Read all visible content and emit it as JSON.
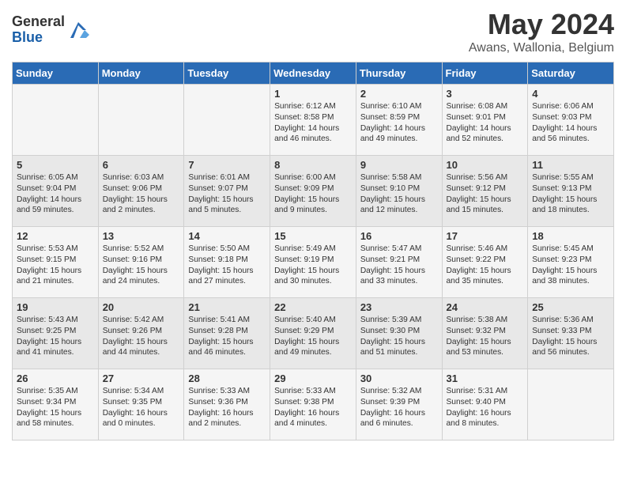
{
  "logo": {
    "general": "General",
    "blue": "Blue"
  },
  "header": {
    "month": "May 2024",
    "location": "Awans, Wallonia, Belgium"
  },
  "weekdays": [
    "Sunday",
    "Monday",
    "Tuesday",
    "Wednesday",
    "Thursday",
    "Friday",
    "Saturday"
  ],
  "weeks": [
    [
      {
        "day": "",
        "sunrise": "",
        "sunset": "",
        "daylight": ""
      },
      {
        "day": "",
        "sunrise": "",
        "sunset": "",
        "daylight": ""
      },
      {
        "day": "",
        "sunrise": "",
        "sunset": "",
        "daylight": ""
      },
      {
        "day": "1",
        "sunrise": "Sunrise: 6:12 AM",
        "sunset": "Sunset: 8:58 PM",
        "daylight": "Daylight: 14 hours and 46 minutes."
      },
      {
        "day": "2",
        "sunrise": "Sunrise: 6:10 AM",
        "sunset": "Sunset: 8:59 PM",
        "daylight": "Daylight: 14 hours and 49 minutes."
      },
      {
        "day": "3",
        "sunrise": "Sunrise: 6:08 AM",
        "sunset": "Sunset: 9:01 PM",
        "daylight": "Daylight: 14 hours and 52 minutes."
      },
      {
        "day": "4",
        "sunrise": "Sunrise: 6:06 AM",
        "sunset": "Sunset: 9:03 PM",
        "daylight": "Daylight: 14 hours and 56 minutes."
      }
    ],
    [
      {
        "day": "5",
        "sunrise": "Sunrise: 6:05 AM",
        "sunset": "Sunset: 9:04 PM",
        "daylight": "Daylight: 14 hours and 59 minutes."
      },
      {
        "day": "6",
        "sunrise": "Sunrise: 6:03 AM",
        "sunset": "Sunset: 9:06 PM",
        "daylight": "Daylight: 15 hours and 2 minutes."
      },
      {
        "day": "7",
        "sunrise": "Sunrise: 6:01 AM",
        "sunset": "Sunset: 9:07 PM",
        "daylight": "Daylight: 15 hours and 5 minutes."
      },
      {
        "day": "8",
        "sunrise": "Sunrise: 6:00 AM",
        "sunset": "Sunset: 9:09 PM",
        "daylight": "Daylight: 15 hours and 9 minutes."
      },
      {
        "day": "9",
        "sunrise": "Sunrise: 5:58 AM",
        "sunset": "Sunset: 9:10 PM",
        "daylight": "Daylight: 15 hours and 12 minutes."
      },
      {
        "day": "10",
        "sunrise": "Sunrise: 5:56 AM",
        "sunset": "Sunset: 9:12 PM",
        "daylight": "Daylight: 15 hours and 15 minutes."
      },
      {
        "day": "11",
        "sunrise": "Sunrise: 5:55 AM",
        "sunset": "Sunset: 9:13 PM",
        "daylight": "Daylight: 15 hours and 18 minutes."
      }
    ],
    [
      {
        "day": "12",
        "sunrise": "Sunrise: 5:53 AM",
        "sunset": "Sunset: 9:15 PM",
        "daylight": "Daylight: 15 hours and 21 minutes."
      },
      {
        "day": "13",
        "sunrise": "Sunrise: 5:52 AM",
        "sunset": "Sunset: 9:16 PM",
        "daylight": "Daylight: 15 hours and 24 minutes."
      },
      {
        "day": "14",
        "sunrise": "Sunrise: 5:50 AM",
        "sunset": "Sunset: 9:18 PM",
        "daylight": "Daylight: 15 hours and 27 minutes."
      },
      {
        "day": "15",
        "sunrise": "Sunrise: 5:49 AM",
        "sunset": "Sunset: 9:19 PM",
        "daylight": "Daylight: 15 hours and 30 minutes."
      },
      {
        "day": "16",
        "sunrise": "Sunrise: 5:47 AM",
        "sunset": "Sunset: 9:21 PM",
        "daylight": "Daylight: 15 hours and 33 minutes."
      },
      {
        "day": "17",
        "sunrise": "Sunrise: 5:46 AM",
        "sunset": "Sunset: 9:22 PM",
        "daylight": "Daylight: 15 hours and 35 minutes."
      },
      {
        "day": "18",
        "sunrise": "Sunrise: 5:45 AM",
        "sunset": "Sunset: 9:23 PM",
        "daylight": "Daylight: 15 hours and 38 minutes."
      }
    ],
    [
      {
        "day": "19",
        "sunrise": "Sunrise: 5:43 AM",
        "sunset": "Sunset: 9:25 PM",
        "daylight": "Daylight: 15 hours and 41 minutes."
      },
      {
        "day": "20",
        "sunrise": "Sunrise: 5:42 AM",
        "sunset": "Sunset: 9:26 PM",
        "daylight": "Daylight: 15 hours and 44 minutes."
      },
      {
        "day": "21",
        "sunrise": "Sunrise: 5:41 AM",
        "sunset": "Sunset: 9:28 PM",
        "daylight": "Daylight: 15 hours and 46 minutes."
      },
      {
        "day": "22",
        "sunrise": "Sunrise: 5:40 AM",
        "sunset": "Sunset: 9:29 PM",
        "daylight": "Daylight: 15 hours and 49 minutes."
      },
      {
        "day": "23",
        "sunrise": "Sunrise: 5:39 AM",
        "sunset": "Sunset: 9:30 PM",
        "daylight": "Daylight: 15 hours and 51 minutes."
      },
      {
        "day": "24",
        "sunrise": "Sunrise: 5:38 AM",
        "sunset": "Sunset: 9:32 PM",
        "daylight": "Daylight: 15 hours and 53 minutes."
      },
      {
        "day": "25",
        "sunrise": "Sunrise: 5:36 AM",
        "sunset": "Sunset: 9:33 PM",
        "daylight": "Daylight: 15 hours and 56 minutes."
      }
    ],
    [
      {
        "day": "26",
        "sunrise": "Sunrise: 5:35 AM",
        "sunset": "Sunset: 9:34 PM",
        "daylight": "Daylight: 15 hours and 58 minutes."
      },
      {
        "day": "27",
        "sunrise": "Sunrise: 5:34 AM",
        "sunset": "Sunset: 9:35 PM",
        "daylight": "Daylight: 16 hours and 0 minutes."
      },
      {
        "day": "28",
        "sunrise": "Sunrise: 5:33 AM",
        "sunset": "Sunset: 9:36 PM",
        "daylight": "Daylight: 16 hours and 2 minutes."
      },
      {
        "day": "29",
        "sunrise": "Sunrise: 5:33 AM",
        "sunset": "Sunset: 9:38 PM",
        "daylight": "Daylight: 16 hours and 4 minutes."
      },
      {
        "day": "30",
        "sunrise": "Sunrise: 5:32 AM",
        "sunset": "Sunset: 9:39 PM",
        "daylight": "Daylight: 16 hours and 6 minutes."
      },
      {
        "day": "31",
        "sunrise": "Sunrise: 5:31 AM",
        "sunset": "Sunset: 9:40 PM",
        "daylight": "Daylight: 16 hours and 8 minutes."
      },
      {
        "day": "",
        "sunrise": "",
        "sunset": "",
        "daylight": ""
      }
    ]
  ]
}
